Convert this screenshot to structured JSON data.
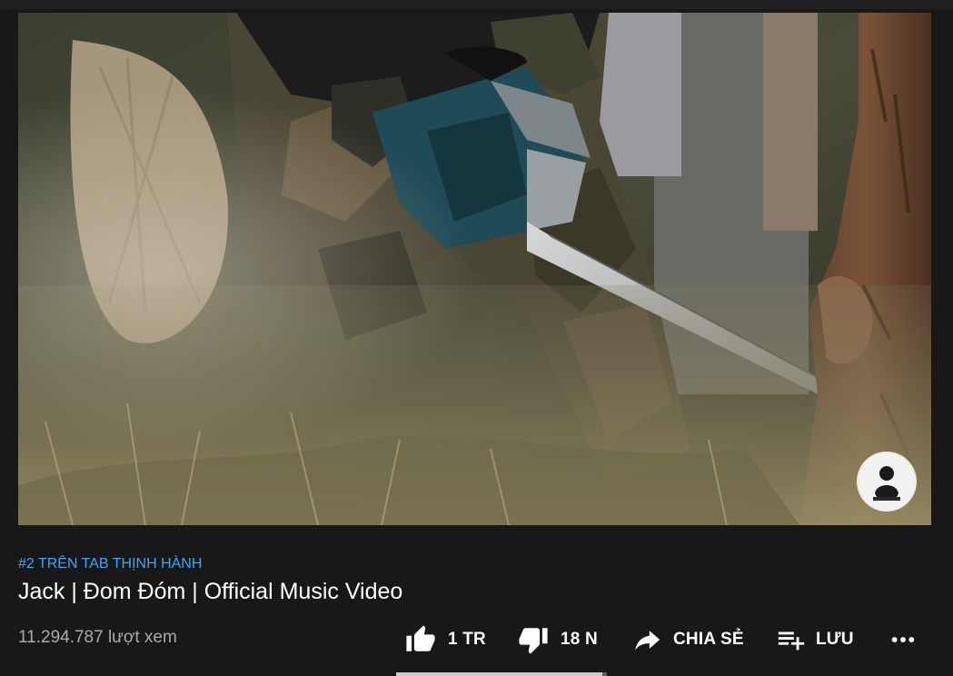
{
  "player": {
    "thumbnail_subject": "chainsaw cutting tree",
    "watermark": "channel-avatar"
  },
  "video": {
    "trending_label": "#2 TRÊN TAB THỊNH HÀNH",
    "title": "Jack | Đom Đóm | Official Music Video",
    "view_count": "11.294.787 lượt xem"
  },
  "actions": {
    "like_label": "1 TR",
    "dislike_label": "18 N",
    "share_label": "CHIA SẺ",
    "save_label": "LƯU",
    "more_icon": "more-horizontal-icon"
  },
  "sentiment": {
    "like_fraction": 0.98
  },
  "colors": {
    "background": "#181818",
    "link": "#3ea6ff",
    "secondary_text": "#aaaaaa",
    "primary_text": "#ffffff"
  }
}
